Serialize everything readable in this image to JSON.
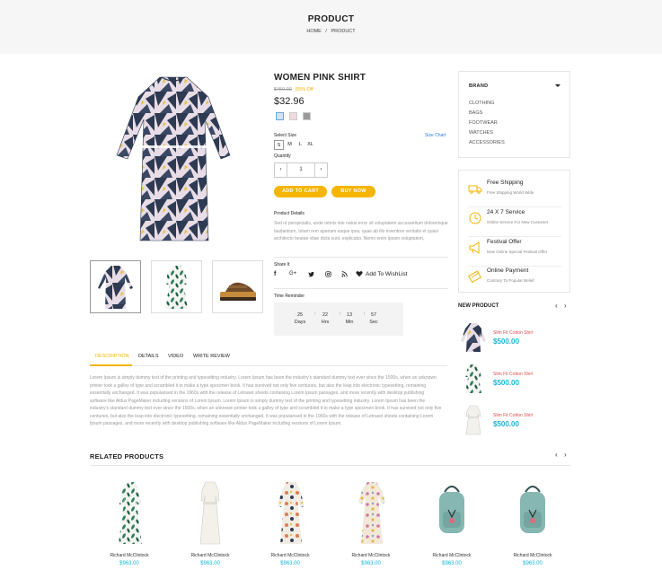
{
  "header": {
    "title": "PRODUCT",
    "breadcrumb_home": "HOME",
    "breadcrumb_sep": "/",
    "breadcrumb_current": "PRODUCT"
  },
  "product": {
    "title": "WOMEN PINK SHIRT",
    "old_price": "$459.00",
    "discount": "55% Off",
    "price": "$32.96",
    "swatches": [
      "#cfe3f5",
      "#f2d9dc",
      "#9a9a9a"
    ],
    "select_size_label": "Select Size",
    "size_chart_label": "Size Chart",
    "sizes": [
      "S",
      "M",
      "L",
      "XL"
    ],
    "quantity_label": "Quantity",
    "quantity": "1",
    "add_to_cart": "ADD TO CART",
    "buy_now": "BUY NOW",
    "details_label": "Product Details",
    "details_text": "Sed ut perspiciatis, unde omnis iste natus error sit voluptatem accusantium doloremque laudantium, totam rem aperiam eaque ipsa, quae ab illo inventore veritatis et quasi architecto beatae vitae dicta sunt, explicabo. Nemo enim ipsam voluptatem,",
    "share_label": "Share It",
    "wishlist": "Add To WishList",
    "timer_label": "Time Reminder",
    "timer": [
      {
        "v": "25",
        "u": "Days"
      },
      {
        "v": "22",
        "u": "Hrs"
      },
      {
        "v": "13",
        "u": "Min"
      },
      {
        "v": "57",
        "u": "Sec"
      }
    ],
    "timer_sep": ":"
  },
  "brand": {
    "title": "BRAND",
    "items": [
      "CLOTHING",
      "BAGS",
      "FOOTWEAR",
      "WATCHES",
      "ACCESSORIES"
    ]
  },
  "services": [
    {
      "title": "Free Shipping",
      "sub": "Free Shipping World Wide",
      "icon": "truck-icon"
    },
    {
      "title": "24 X 7 Service",
      "sub": "Online Service For New Customer",
      "icon": "support-clock-icon"
    },
    {
      "title": "Festival Offer",
      "sub": "New Online Special Festival Offer",
      "icon": "megaphone-icon"
    },
    {
      "title": "Online Payment",
      "sub": "Contrary To Popular Belief.",
      "icon": "payment-card-icon"
    }
  ],
  "new_product": {
    "title": "NEW PRODUCT",
    "items": [
      {
        "name": "Slim Fit Cotton Shirt",
        "price": "$500.00"
      },
      {
        "name": "Slim Fit Cotton Shirt",
        "price": "$500.00"
      },
      {
        "name": "Slim Fit Cotton Shirt",
        "price": "$500.00"
      }
    ]
  },
  "tabs": [
    "DESCRIPTION",
    "DETAILS",
    "VIDEO",
    "WRITE REVIEW"
  ],
  "description": "Lorem Ipsum is simply dummy text of the printing and typesetting industry. Lorem Ipsum has been the industry's standard dummy text ever since the 1500s, when an unknown printer took a galley of type and scrambled it to make a type specimen book. It has survived not only five centuries, but also the leap into electronic typesetting, remaining essentially unchanged. It was popularised in the 1960s with the release of Letraset sheets containing Lorem Ipsum passages, and more recently with desktop publishing software like Aldus PageMaker including versions of Lorem Ipsum. Lorem Ipsum is simply dummy text of the printing and typesetting industry. Lorem Ipsum has been the industry's standard dummy text ever since the 1500s, when an unknown printer took a galley of type and scrambled it to make a type specimen book. It has survived not only five centuries, but also the leap into electronic typesetting, remaining essentially unchanged. It was popularised in the 1960s with the release of Letraset sheets containing Lorem Ipsum passages, and more recently with desktop publishing software like Aldus PageMaker including versions of Lorem Ipsum.",
  "related": {
    "title": "RELATED PRODUCTS",
    "items": [
      {
        "name": "Richard McClintock",
        "price": "$963.00"
      },
      {
        "name": "Richard McClintock",
        "price": "$963.00"
      },
      {
        "name": "Richard McClintock",
        "price": "$963.00"
      },
      {
        "name": "Richard McClintock",
        "price": "$963.00"
      },
      {
        "name": "Richard McClintock",
        "price": "$963.00"
      },
      {
        "name": "Richard McClintock",
        "price": "$963.00"
      }
    ]
  },
  "colors": {
    "accent": "#f5b400",
    "price_blue": "#18b5d6",
    "link": "#2a7ae2"
  }
}
